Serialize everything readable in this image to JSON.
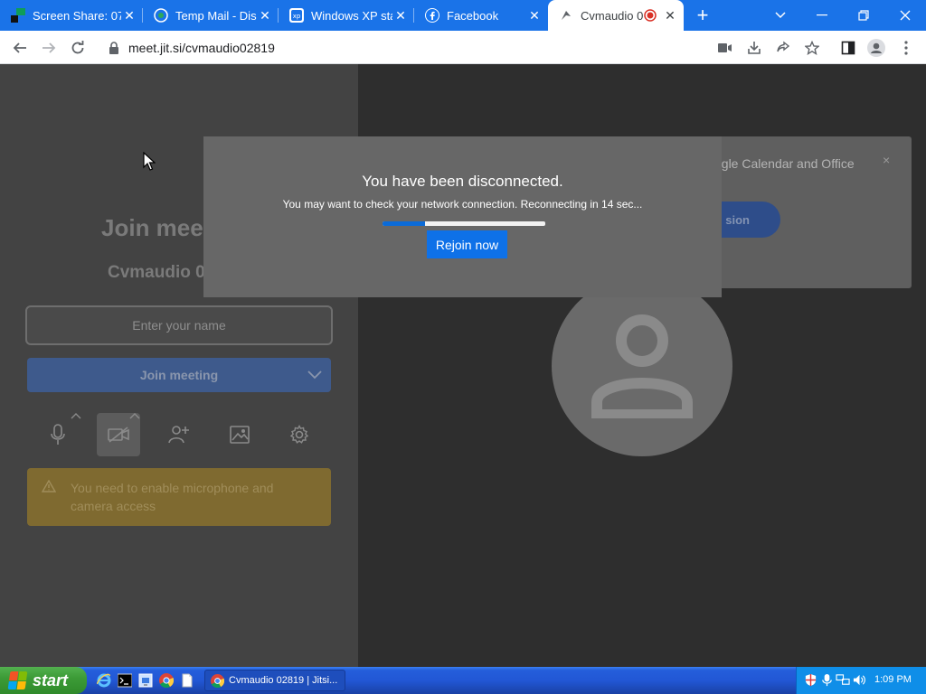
{
  "browser": {
    "tabs": [
      {
        "title": "Screen Share: 07",
        "icon": "screenshare-favicon-icon",
        "active": false
      },
      {
        "title": "Temp Mail - Disp",
        "icon": "tempmail-favicon-icon",
        "active": false
      },
      {
        "title": "Windows XP sta",
        "icon": "winxp-favicon-icon",
        "active": false
      },
      {
        "title": "Facebook",
        "icon": "facebook-favicon-icon",
        "active": false
      },
      {
        "title": "Cvmaudio 0",
        "icon": "jitsi-favicon-icon",
        "active": true,
        "recording": true
      }
    ],
    "new_tab_label": "+",
    "url": "meet.jit.si/cvmaudio02819"
  },
  "prejoin": {
    "title": "Join mee",
    "room_name": "Cvmaudio 0",
    "name_placeholder": "Enter your name",
    "join_button": "Join meeting",
    "warning": "You need to enable microphone and camera access"
  },
  "notification": {
    "text": "ogle Calendar and Office",
    "close_label": "×",
    "button_label": "sion"
  },
  "modal": {
    "title": "You have been disconnected.",
    "message": "You may want to check your network connection. Reconnecting in 14 sec...",
    "progress": 0.26,
    "rejoin_label": "Rejoin now"
  },
  "taskbar": {
    "start_label": "start",
    "task_item": "Cvmaudio 02819 | Jitsi...",
    "clock": "1:09 PM"
  },
  "colors": {
    "chrome_tabstrip": "#1a73e8",
    "rejoin_button": "#0e71e8",
    "xp_start": "#3c9b37",
    "xp_taskbar": "#245edb"
  }
}
